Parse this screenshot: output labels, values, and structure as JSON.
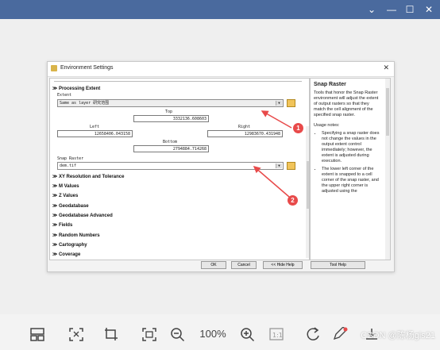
{
  "window_controls": {
    "chevron": "⌄",
    "minimize": "—",
    "maximize": "☐",
    "close": "✕"
  },
  "dialog": {
    "title": "Environment Settings",
    "close": "✕",
    "processing_extent": "Processing Extent",
    "extent_label": "Extent",
    "extent_value": "Same as layer 研究范围",
    "top_label": "Top",
    "top_value": "3332136.608603",
    "left_label": "Left",
    "left_value": "12658406.043158",
    "right_label": "Right",
    "right_value": "12983670.431948",
    "bottom_label": "Bottom",
    "bottom_value": "2794884.714268",
    "snap_label": "Snap Raster",
    "snap_value": "dem.tif",
    "sections": [
      "XY Resolution and Tolerance",
      "M Values",
      "Z Values",
      "Geodatabase",
      "Geodatabase Advanced",
      "Fields",
      "Random Numbers",
      "Cartography",
      "Coverage"
    ],
    "buttons": {
      "ok": "OK",
      "cancel": "Cancel",
      "hide_help": "<< Hide Help",
      "tool_help": "Tool Help"
    },
    "help_title": "Snap Raster",
    "help_para": "Tools that honor the Snap Raster environment will adjust the extent of output rasters so that they match the cell alignment of the specified snap raster.",
    "usage_label": "Usage notes:",
    "bullets": [
      "Specifying a snap raster does not change the values in the output extent control immediately; however, the extent is adjusted during execution.",
      "The lower left corner of the extent is snapped to a cell corner of the snap raster, and the upper right corner is adjusted using the"
    ]
  },
  "annotations": {
    "one": "1",
    "two": "2"
  },
  "toolbar": {
    "zoom": "100%",
    "icons": [
      "layout-icon",
      "fit-icon",
      "crop-icon",
      "fullscreen-icon",
      "zoom-out-icon",
      "zoom-in-icon",
      "actual-size-icon",
      "rotate-icon",
      "edit-icon",
      "download-icon"
    ],
    "watermark": "CSDN @陈杨gis21"
  },
  "colors": {
    "titlebar": "#4a6a9e",
    "annotation": "#e84a4a"
  }
}
